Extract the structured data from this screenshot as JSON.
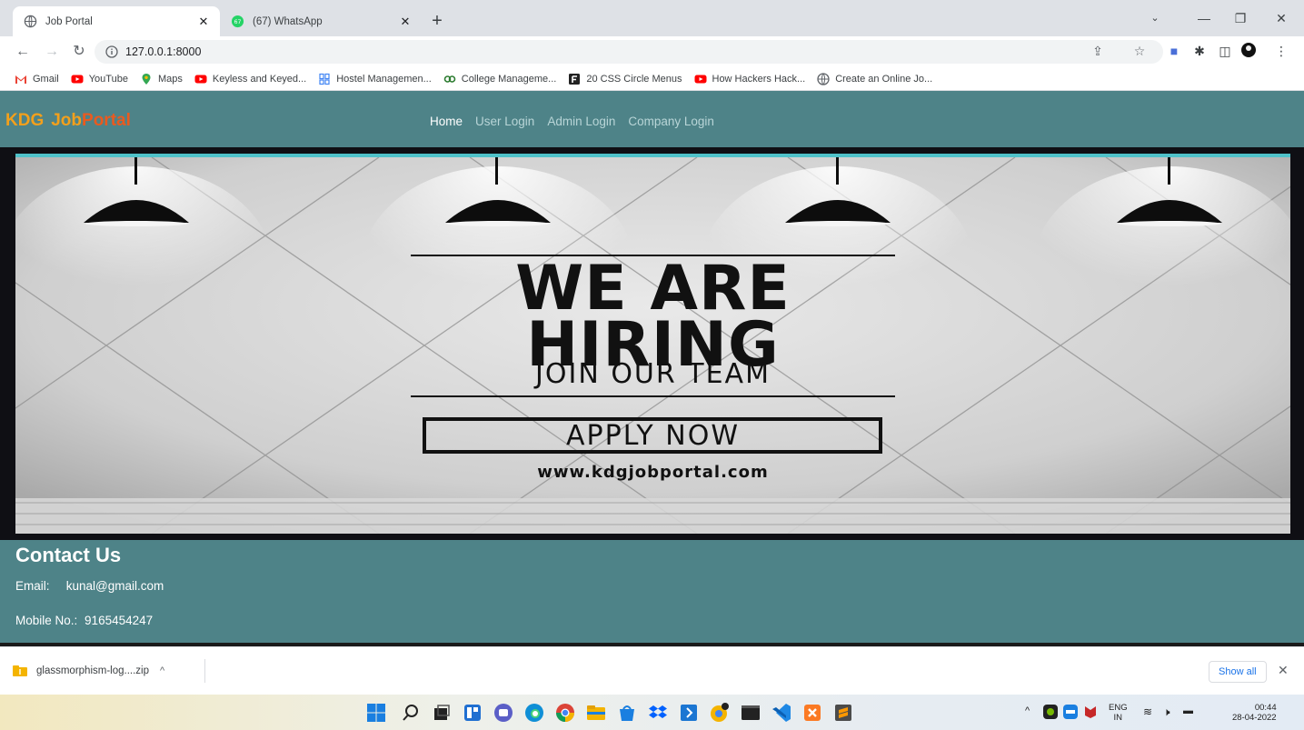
{
  "browser": {
    "tabs": [
      {
        "title": "Job Portal",
        "active": true
      },
      {
        "title": "(67) WhatsApp",
        "active": false,
        "badge": "67"
      }
    ],
    "url": "127.0.0.1:8000",
    "bookmarks": [
      {
        "label": "Gmail",
        "icon": "gmail-icon"
      },
      {
        "label": "YouTube",
        "icon": "youtube-icon"
      },
      {
        "label": "Maps",
        "icon": "maps-icon"
      },
      {
        "label": "Keyless and Keyed...",
        "icon": "youtube-icon"
      },
      {
        "label": "Hostel Managemen...",
        "icon": "document-icon"
      },
      {
        "label": "College Manageme...",
        "icon": "logo-icon"
      },
      {
        "label": "20 CSS Circle Menus",
        "icon": "f-icon"
      },
      {
        "label": "How Hackers Hack...",
        "icon": "youtube-icon"
      },
      {
        "label": "Create an Online Jo...",
        "icon": "globe-icon"
      }
    ]
  },
  "site": {
    "brand": {
      "kdg": "KDG",
      "job": "Job",
      "portal": "Portal"
    },
    "nav": [
      {
        "label": "Home",
        "active": true
      },
      {
        "label": "User Login",
        "active": false
      },
      {
        "label": "Admin Login",
        "active": false
      },
      {
        "label": "Company Login",
        "active": false
      }
    ],
    "hero": {
      "line1": "WE ARE",
      "line2": "HIRING",
      "line3": "JOIN OUR TEAM",
      "cta": "APPLY NOW",
      "website": "www.kdgjobportal.com"
    },
    "contact": {
      "title": "Contact Us",
      "email_label": "Email:",
      "email": "kunal@gmail.com",
      "mobile_label": "Mobile No.:",
      "mobile": "9165454247"
    }
  },
  "downloads": {
    "file": "glassmorphism-log....zip",
    "show_all": "Show all"
  },
  "taskbar": {
    "lang_top": "ENG",
    "lang_bottom": "IN",
    "time": "00:44",
    "date": "28-04-2022"
  },
  "colors": {
    "header_bg": "#4e8388",
    "brand_orange": "#f3a01c",
    "brand_red": "#ea5a1f",
    "accent_cyan": "#4fc1c9"
  }
}
